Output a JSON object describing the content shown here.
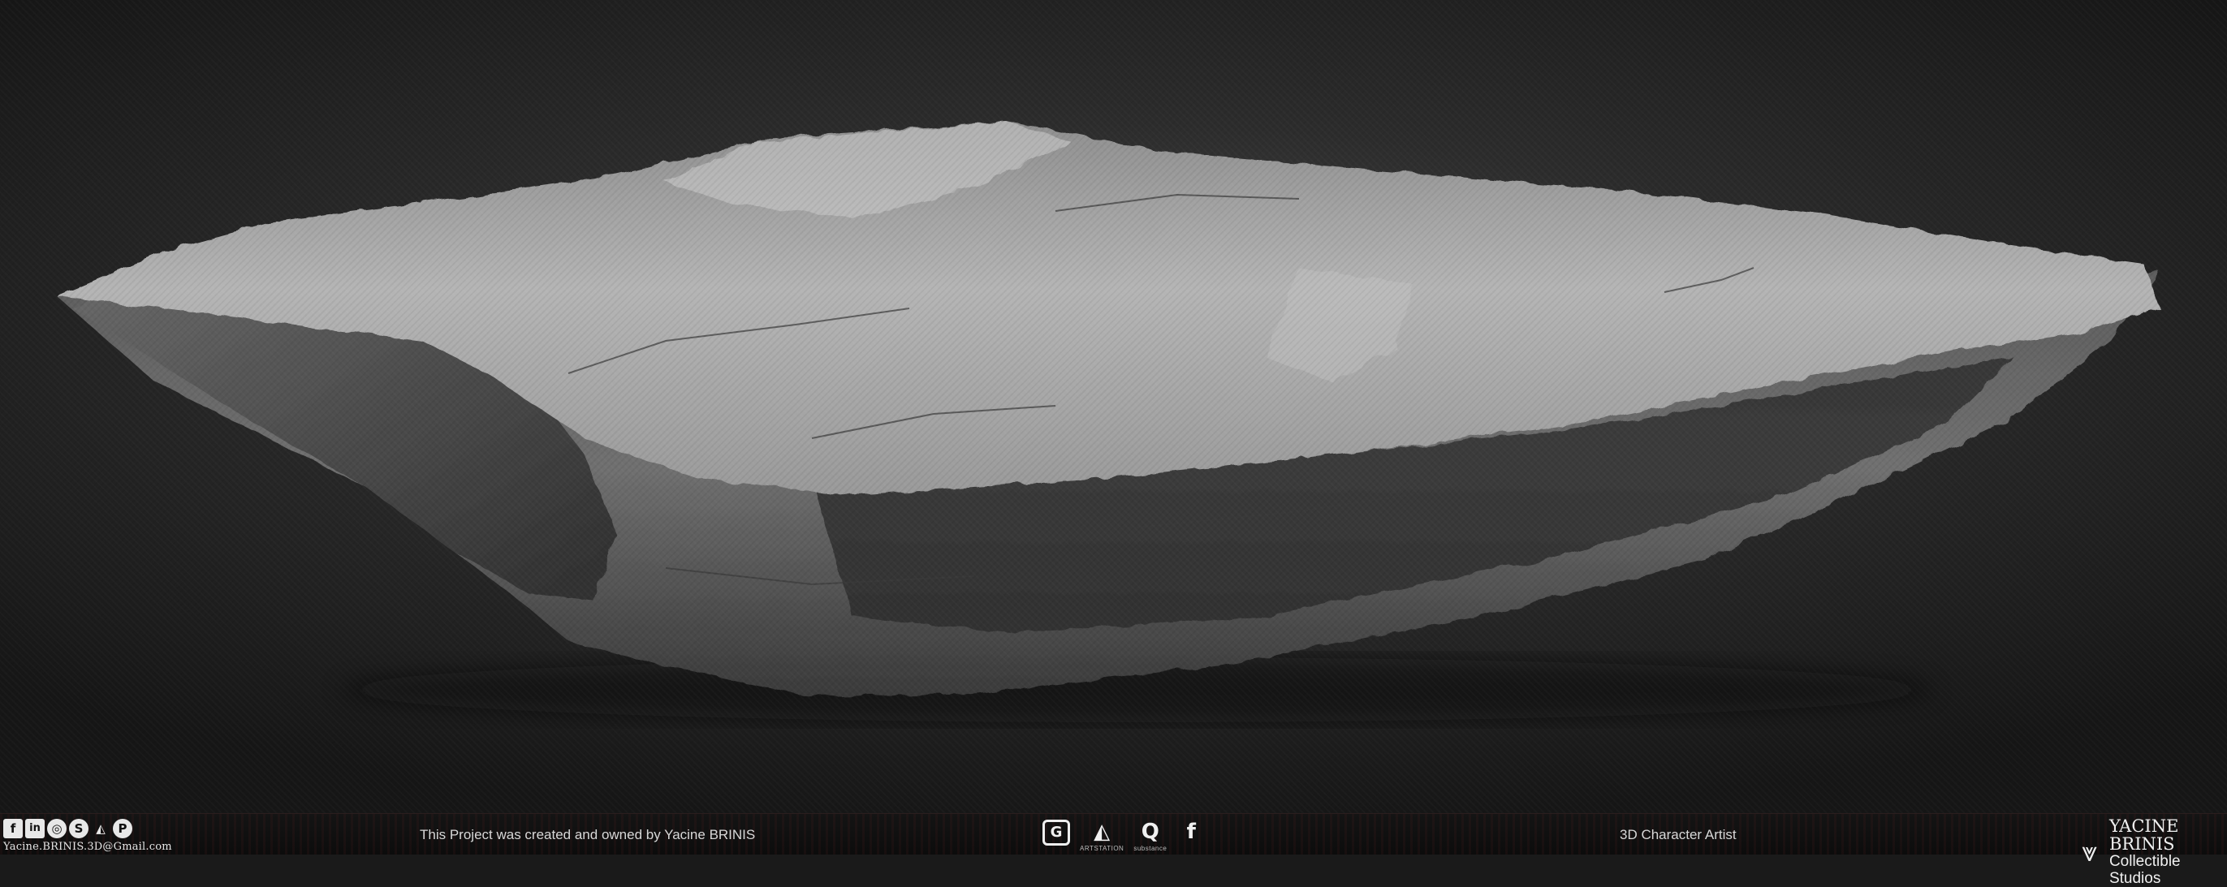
{
  "social": {
    "icons": [
      {
        "name": "facebook-icon",
        "glyph": "f"
      },
      {
        "name": "linkedin-icon",
        "glyph": "in"
      },
      {
        "name": "instagram-icon",
        "glyph": "◎"
      },
      {
        "name": "skype-icon",
        "glyph": "S"
      },
      {
        "name": "artstation-icon",
        "glyph": "◭"
      },
      {
        "name": "pinterest-icon",
        "glyph": "P"
      }
    ],
    "email": "Yacine.BRINIS.3D@Gmail.com"
  },
  "footer": {
    "ownership": "This Project was created and owned by Yacine BRINIS",
    "job_title": "3D Character Artist"
  },
  "software": [
    {
      "name": "grab-tool-icon",
      "glyph": "G",
      "label": ""
    },
    {
      "name": "artstation-logo-icon",
      "glyph": "◭",
      "label": "ARTSTATION"
    },
    {
      "name": "substance-logo-icon",
      "glyph": "Q",
      "label": "substance"
    },
    {
      "name": "fusion-logo-icon",
      "glyph": "f",
      "label": ""
    }
  ],
  "brand": {
    "logo_glyph": "⩔",
    "name": "YACINE BRINIS",
    "subtitle": "Collectible Studios"
  },
  "colors": {
    "background": "#1a1a1a",
    "rock_light": "#b8b8b8",
    "rock_dark": "#3a3a3a",
    "footer_text": "#d8d8d8"
  }
}
